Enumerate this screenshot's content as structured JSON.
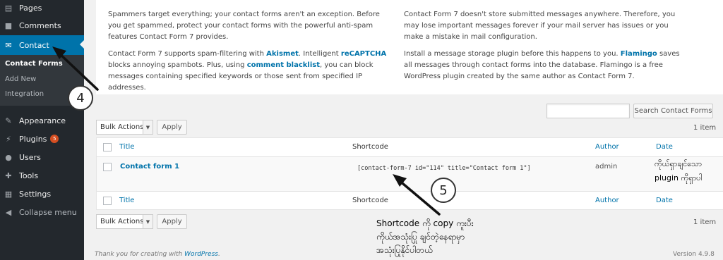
{
  "sidebar": {
    "items": [
      {
        "label": "Pages",
        "icon": "pages-icon"
      },
      {
        "label": "Comments",
        "icon": "comments-icon"
      },
      {
        "label": "Contact",
        "icon": "mail-icon"
      },
      {
        "label": "Appearance",
        "icon": "appearance-icon"
      },
      {
        "label": "Plugins",
        "icon": "plugins-icon",
        "badge": "5"
      },
      {
        "label": "Users",
        "icon": "users-icon"
      },
      {
        "label": "Tools",
        "icon": "tools-icon"
      },
      {
        "label": "Settings",
        "icon": "settings-icon"
      },
      {
        "label": "Collapse menu",
        "icon": "collapse-icon"
      }
    ],
    "submenu": [
      "Contact Forms",
      "Add New",
      "Integration"
    ]
  },
  "notice": {
    "left": {
      "p1": "Spammers target everything; your contact forms aren't an exception. Before you get spammed, protect your contact forms with the powerful anti-spam features Contact Form 7 provides.",
      "p2_a": "Contact Form 7 supports spam-filtering with ",
      "p2_link1": "Akismet",
      "p2_b": ". Intelligent ",
      "p2_link2": "reCAPTCHA",
      "p2_c": " blocks annoying spambots. Plus, using ",
      "p2_link3": "comment blacklist",
      "p2_d": ", you can block messages containing specified keywords or those sent from specified IP addresses."
    },
    "right": {
      "p1": "Contact Form 7 doesn't store submitted messages anywhere. Therefore, you may lose important messages forever if your mail server has issues or you make a mistake in mail configuration.",
      "p2_a": "Install a message storage plugin before this happens to you. ",
      "p2_link": "Flamingo",
      "p2_b": " saves all messages through contact forms into the database. Flamingo is a free WordPress plugin created by the same author as Contact Form 7."
    }
  },
  "search": {
    "value": "",
    "button": "Search Contact Forms"
  },
  "bulk": {
    "selected": "Bulk Actions",
    "apply": "Apply"
  },
  "item_count": "1 item",
  "table": {
    "headers": {
      "title": "Title",
      "shortcode": "Shortcode",
      "author": "Author",
      "date": "Date"
    },
    "row": {
      "title": "Contact form 1",
      "shortcode": "[contact-form-7 id=\"114\" title=\"Contact form 1\"]",
      "author": "admin",
      "date_line1": "ကိုယ်ရှာချင်သော",
      "date_line2": "plugin ကိုရှာပါ"
    }
  },
  "footer": {
    "thanks": "Thank you for creating with ",
    "link": "WordPress",
    "period": ".",
    "version": "Version 4.9.8"
  },
  "annotations": {
    "step4": "4",
    "step5": "5",
    "note_line1": "Shortcode ကို copy ကူးပီး",
    "note_line2": "ကိုယ်အသုံးပြု ချင်တဲ့နေရာမှာ",
    "note_line3": "အသုံးပြုနိုင်ပါတယ်"
  },
  "colors": {
    "sidebar": "#23282d",
    "active": "#0073aa",
    "link": "#0073aa",
    "badge": "#d54e21"
  }
}
